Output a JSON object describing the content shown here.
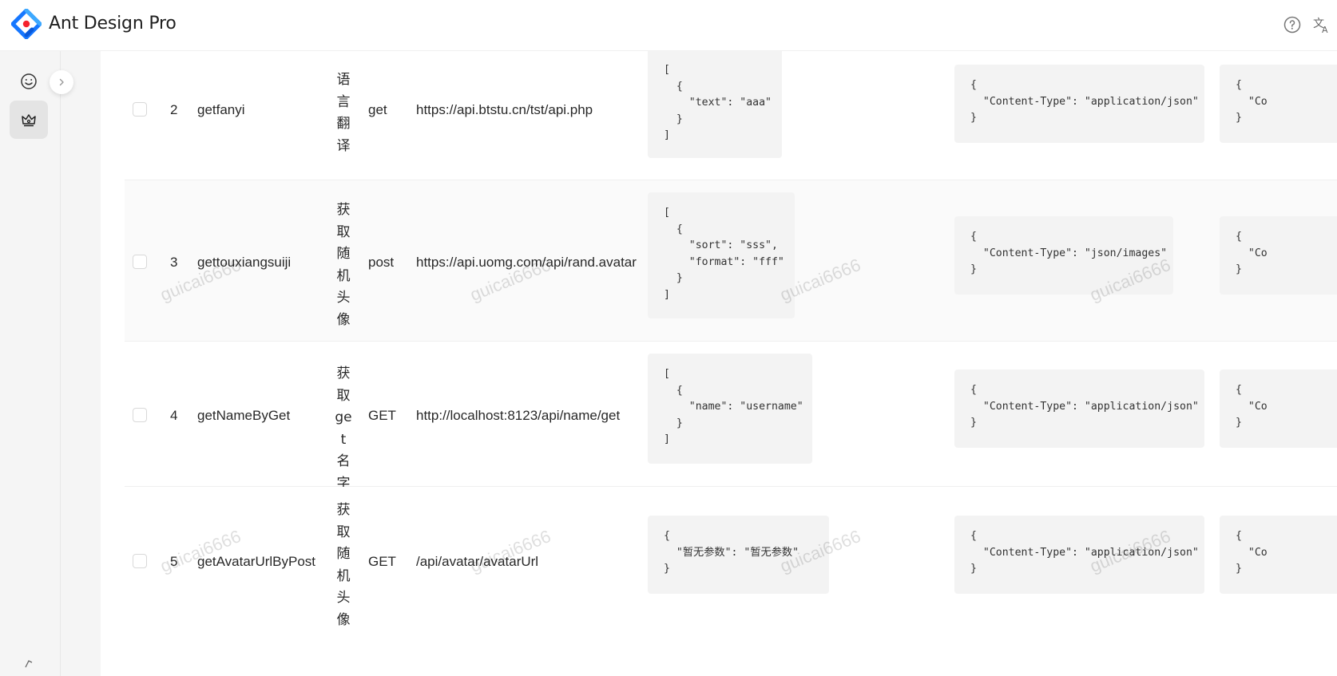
{
  "app": {
    "title": "Ant Design Pro"
  },
  "header": {
    "help_icon": "question-circle-icon",
    "lang_icon": "translation-icon"
  },
  "sidebar": {
    "items": [
      {
        "icon": "smile-icon",
        "active": false
      },
      {
        "icon": "crown-icon",
        "active": true
      }
    ],
    "collapse_icon": "chevron-right-icon"
  },
  "table": {
    "rows": [
      {
        "id": "2",
        "name": "getfanyi",
        "description": "语言翻译",
        "method": "get",
        "url": "https://api.btstu.cn/tst/api.php",
        "request_params": "[\n  {\n    \"text\": \"aaa\"\n  }\n]",
        "request_header": "{\n  \"Content-Type\": \"application/json\"\n}",
        "response_header": "{\n  \"Co\n}"
      },
      {
        "id": "3",
        "name": "gettouxiangsuiji",
        "description": "获取随机头像",
        "method": "post",
        "url": "https://api.uomg.com/api/rand.avatar",
        "request_params": "[\n  {\n    \"sort\": \"sss\",\n    \"format\": \"fff\"\n  }\n]",
        "request_header": "{\n  \"Content-Type\": \"json/images\"\n}",
        "response_header": "{\n  \"Co\n}"
      },
      {
        "id": "4",
        "name": "getNameByGet",
        "description": "获取get名字",
        "method": "GET",
        "url": "http://localhost:8123/api/name/get",
        "request_params": "[\n  {\n    \"name\": \"username\"\n  }\n]",
        "request_header": "{\n  \"Content-Type\": \"application/json\"\n}",
        "response_header": "{\n  \"Co\n}"
      },
      {
        "id": "5",
        "name": "getAvatarUrlByPost",
        "description": "获取随机头像",
        "method": "GET",
        "url": "/api/avatar/avatarUrl",
        "request_params": "{\n  \"暂无参数\": \"暂无参数\"\n}",
        "request_header": "{\n  \"Content-Type\": \"application/json\"\n}",
        "response_header": "{\n  \"Co\n}"
      }
    ]
  },
  "watermark": {
    "text": "guicai6666"
  },
  "colors": {
    "logo_blue": "#1677ff",
    "logo_red": "#f5222d",
    "code_bg": "#f3f3f3"
  }
}
